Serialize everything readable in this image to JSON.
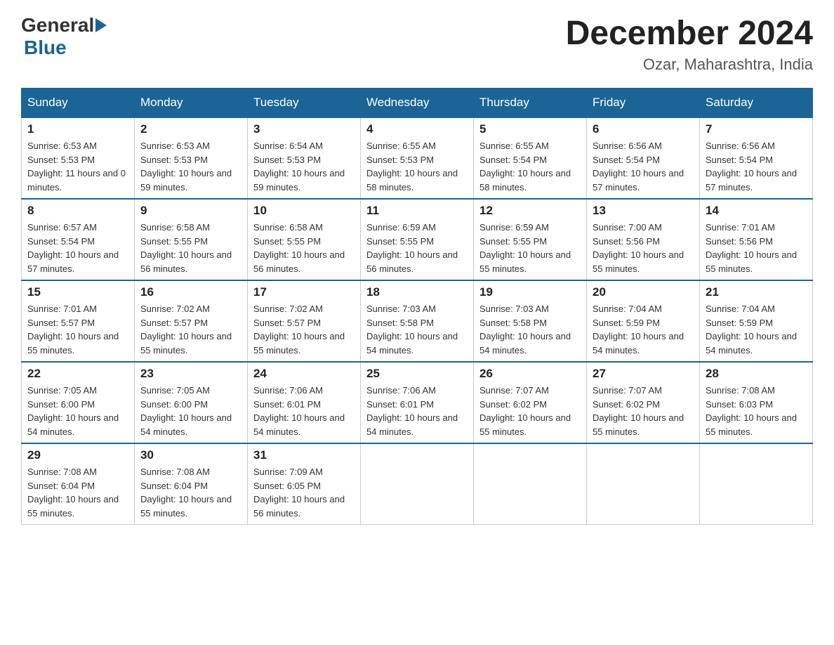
{
  "logo": {
    "general": "General",
    "blue": "Blue"
  },
  "header": {
    "title": "December 2024",
    "location": "Ozar, Maharashtra, India"
  },
  "days_of_week": [
    "Sunday",
    "Monday",
    "Tuesday",
    "Wednesday",
    "Thursday",
    "Friday",
    "Saturday"
  ],
  "weeks": [
    [
      {
        "date": "1",
        "sunrise": "6:53 AM",
        "sunset": "5:53 PM",
        "daylight": "11 hours and 0 minutes."
      },
      {
        "date": "2",
        "sunrise": "6:53 AM",
        "sunset": "5:53 PM",
        "daylight": "10 hours and 59 minutes."
      },
      {
        "date": "3",
        "sunrise": "6:54 AM",
        "sunset": "5:53 PM",
        "daylight": "10 hours and 59 minutes."
      },
      {
        "date": "4",
        "sunrise": "6:55 AM",
        "sunset": "5:53 PM",
        "daylight": "10 hours and 58 minutes."
      },
      {
        "date": "5",
        "sunrise": "6:55 AM",
        "sunset": "5:54 PM",
        "daylight": "10 hours and 58 minutes."
      },
      {
        "date": "6",
        "sunrise": "6:56 AM",
        "sunset": "5:54 PM",
        "daylight": "10 hours and 57 minutes."
      },
      {
        "date": "7",
        "sunrise": "6:56 AM",
        "sunset": "5:54 PM",
        "daylight": "10 hours and 57 minutes."
      }
    ],
    [
      {
        "date": "8",
        "sunrise": "6:57 AM",
        "sunset": "5:54 PM",
        "daylight": "10 hours and 57 minutes."
      },
      {
        "date": "9",
        "sunrise": "6:58 AM",
        "sunset": "5:55 PM",
        "daylight": "10 hours and 56 minutes."
      },
      {
        "date": "10",
        "sunrise": "6:58 AM",
        "sunset": "5:55 PM",
        "daylight": "10 hours and 56 minutes."
      },
      {
        "date": "11",
        "sunrise": "6:59 AM",
        "sunset": "5:55 PM",
        "daylight": "10 hours and 56 minutes."
      },
      {
        "date": "12",
        "sunrise": "6:59 AM",
        "sunset": "5:55 PM",
        "daylight": "10 hours and 55 minutes."
      },
      {
        "date": "13",
        "sunrise": "7:00 AM",
        "sunset": "5:56 PM",
        "daylight": "10 hours and 55 minutes."
      },
      {
        "date": "14",
        "sunrise": "7:01 AM",
        "sunset": "5:56 PM",
        "daylight": "10 hours and 55 minutes."
      }
    ],
    [
      {
        "date": "15",
        "sunrise": "7:01 AM",
        "sunset": "5:57 PM",
        "daylight": "10 hours and 55 minutes."
      },
      {
        "date": "16",
        "sunrise": "7:02 AM",
        "sunset": "5:57 PM",
        "daylight": "10 hours and 55 minutes."
      },
      {
        "date": "17",
        "sunrise": "7:02 AM",
        "sunset": "5:57 PM",
        "daylight": "10 hours and 55 minutes."
      },
      {
        "date": "18",
        "sunrise": "7:03 AM",
        "sunset": "5:58 PM",
        "daylight": "10 hours and 54 minutes."
      },
      {
        "date": "19",
        "sunrise": "7:03 AM",
        "sunset": "5:58 PM",
        "daylight": "10 hours and 54 minutes."
      },
      {
        "date": "20",
        "sunrise": "7:04 AM",
        "sunset": "5:59 PM",
        "daylight": "10 hours and 54 minutes."
      },
      {
        "date": "21",
        "sunrise": "7:04 AM",
        "sunset": "5:59 PM",
        "daylight": "10 hours and 54 minutes."
      }
    ],
    [
      {
        "date": "22",
        "sunrise": "7:05 AM",
        "sunset": "6:00 PM",
        "daylight": "10 hours and 54 minutes."
      },
      {
        "date": "23",
        "sunrise": "7:05 AM",
        "sunset": "6:00 PM",
        "daylight": "10 hours and 54 minutes."
      },
      {
        "date": "24",
        "sunrise": "7:06 AM",
        "sunset": "6:01 PM",
        "daylight": "10 hours and 54 minutes."
      },
      {
        "date": "25",
        "sunrise": "7:06 AM",
        "sunset": "6:01 PM",
        "daylight": "10 hours and 54 minutes."
      },
      {
        "date": "26",
        "sunrise": "7:07 AM",
        "sunset": "6:02 PM",
        "daylight": "10 hours and 55 minutes."
      },
      {
        "date": "27",
        "sunrise": "7:07 AM",
        "sunset": "6:02 PM",
        "daylight": "10 hours and 55 minutes."
      },
      {
        "date": "28",
        "sunrise": "7:08 AM",
        "sunset": "6:03 PM",
        "daylight": "10 hours and 55 minutes."
      }
    ],
    [
      {
        "date": "29",
        "sunrise": "7:08 AM",
        "sunset": "6:04 PM",
        "daylight": "10 hours and 55 minutes."
      },
      {
        "date": "30",
        "sunrise": "7:08 AM",
        "sunset": "6:04 PM",
        "daylight": "10 hours and 55 minutes."
      },
      {
        "date": "31",
        "sunrise": "7:09 AM",
        "sunset": "6:05 PM",
        "daylight": "10 hours and 56 minutes."
      },
      null,
      null,
      null,
      null
    ]
  ]
}
